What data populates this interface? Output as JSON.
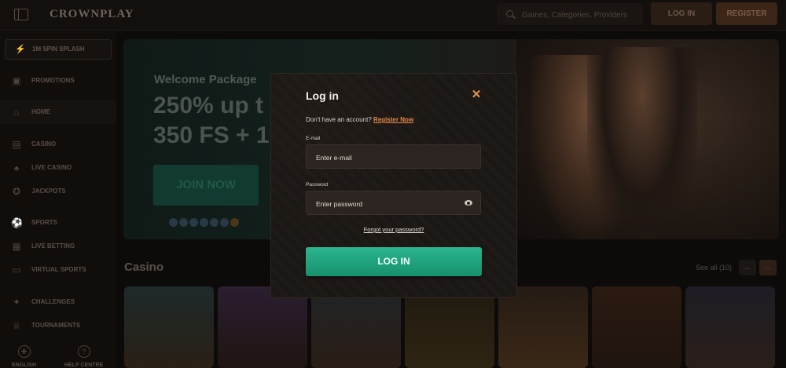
{
  "header": {
    "logo": "CROWNPLAY",
    "search_placeholder": "Games, Categories, Providers",
    "login_label": "LOG IN",
    "register_label": "REGISTER"
  },
  "sidebar": {
    "spin_label": "1M SPIN SPLASH",
    "items": [
      {
        "label": "PROMOTIONS",
        "icon": "gift-icon"
      },
      {
        "label": "HOME",
        "icon": "home-icon"
      },
      {
        "label": "CASINO",
        "icon": "slot-icon"
      },
      {
        "label": "LIVE CASINO",
        "icon": "spade-icon"
      },
      {
        "label": "JACKPOTS",
        "icon": "coin-icon"
      },
      {
        "label": "SPORTS",
        "icon": "ball-icon"
      },
      {
        "label": "LIVE BETTING",
        "icon": "live-icon"
      },
      {
        "label": "VIRTUAL SPORTS",
        "icon": "gamepad-icon"
      },
      {
        "label": "CHALLENGES",
        "icon": "medal-icon"
      },
      {
        "label": "TOURNAMENTS",
        "icon": "trophy-icon"
      }
    ],
    "language": "ENGLISH",
    "help": "HELP CENTRE"
  },
  "banner": {
    "welcome": "Welcome Package",
    "headline_line1": "250% up t",
    "headline_line2": "350 FS + 1",
    "cta": "JOIN NOW"
  },
  "casino_section": {
    "title": "Casino",
    "see_all": "See all (10)"
  },
  "modal": {
    "title": "Log in",
    "no_account_text": "Don't have an account?",
    "register_link": "Register Now",
    "email_label": "E-mail",
    "email_placeholder": "Enter e-mail",
    "password_label": "Password",
    "password_placeholder": "Enter password",
    "forgot": "Forgot your password?",
    "submit": "LOG IN"
  },
  "colors": {
    "accent_orange": "#e58a4a",
    "accent_green": "#1fa47f",
    "modal_bg": "#1b1714"
  }
}
